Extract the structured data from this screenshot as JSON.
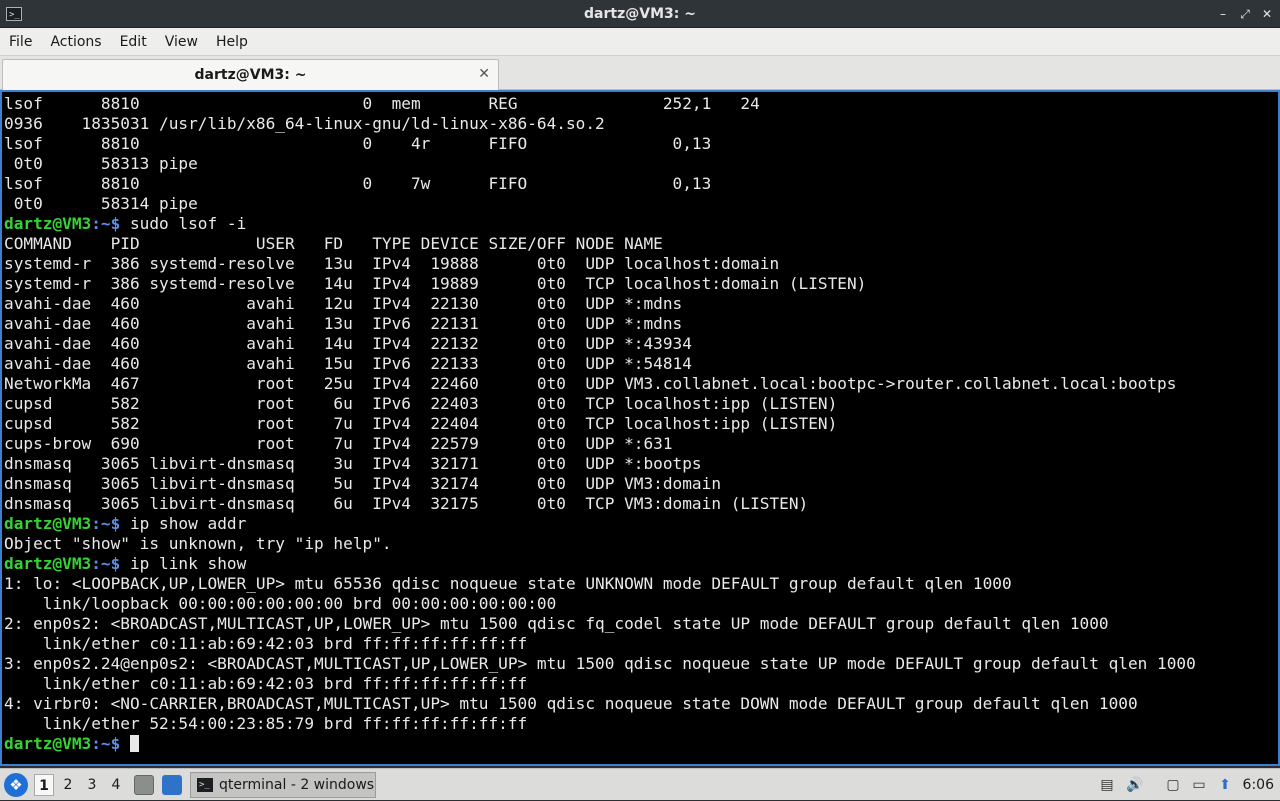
{
  "window": {
    "title": "dartz@VM3: ~",
    "app_icon_glyph": ">_",
    "buttons": {
      "minimize": "–",
      "maximize": "⤢",
      "close": "✕"
    }
  },
  "menubar": {
    "items": [
      "File",
      "Actions",
      "Edit",
      "View",
      "Help"
    ]
  },
  "tabs": [
    {
      "label": "dartz@VM3: ~",
      "close": "✕"
    }
  ],
  "terminal": {
    "colors": {
      "background": "#000000",
      "text": "#e9e9e9",
      "prompt_user": "#35d435",
      "prompt_path": "#5b8fe8"
    },
    "lines": [
      {
        "text": "lsof      8810                       0  mem       REG               252,1   24"
      },
      {
        "text": "0936    1835031 /usr/lib/x86_64-linux-gnu/ld-linux-x86-64.so.2"
      },
      {
        "text": "lsof      8810                       0    4r      FIFO               0,13"
      },
      {
        "text": " 0t0      58313 pipe"
      },
      {
        "text": "lsof      8810                       0    7w      FIFO               0,13"
      },
      {
        "text": " 0t0      58314 pipe"
      },
      {
        "prompt_user": "dartz@VM3",
        "prompt_path": ":~$",
        "text": " sudo lsof -i"
      },
      {
        "text": "COMMAND    PID            USER   FD   TYPE DEVICE SIZE/OFF NODE NAME"
      },
      {
        "text": "systemd-r  386 systemd-resolve   13u  IPv4  19888      0t0  UDP localhost:domain"
      },
      {
        "text": "systemd-r  386 systemd-resolve   14u  IPv4  19889      0t0  TCP localhost:domain (LISTEN)"
      },
      {
        "text": "avahi-dae  460           avahi   12u  IPv4  22130      0t0  UDP *:mdns"
      },
      {
        "text": "avahi-dae  460           avahi   13u  IPv6  22131      0t0  UDP *:mdns"
      },
      {
        "text": "avahi-dae  460           avahi   14u  IPv4  22132      0t0  UDP *:43934"
      },
      {
        "text": "avahi-dae  460           avahi   15u  IPv6  22133      0t0  UDP *:54814"
      },
      {
        "text": "NetworkMa  467            root   25u  IPv4  22460      0t0  UDP VM3.collabnet.local:bootpc->router.collabnet.local:bootps"
      },
      {
        "text": "cupsd      582            root    6u  IPv6  22403      0t0  TCP localhost:ipp (LISTEN)"
      },
      {
        "text": "cupsd      582            root    7u  IPv4  22404      0t0  TCP localhost:ipp (LISTEN)"
      },
      {
        "text": "cups-brow  690            root    7u  IPv4  22579      0t0  UDP *:631"
      },
      {
        "text": "dnsmasq   3065 libvirt-dnsmasq    3u  IPv4  32171      0t0  UDP *:bootps"
      },
      {
        "text": "dnsmasq   3065 libvirt-dnsmasq    5u  IPv4  32174      0t0  UDP VM3:domain"
      },
      {
        "text": "dnsmasq   3065 libvirt-dnsmasq    6u  IPv4  32175      0t0  TCP VM3:domain (LISTEN)"
      },
      {
        "prompt_user": "dartz@VM3",
        "prompt_path": ":~$",
        "text": " ip show addr"
      },
      {
        "text": "Object \"show\" is unknown, try \"ip help\"."
      },
      {
        "prompt_user": "dartz@VM3",
        "prompt_path": ":~$",
        "text": " ip link show"
      },
      {
        "text": "1: lo: <LOOPBACK,UP,LOWER_UP> mtu 65536 qdisc noqueue state UNKNOWN mode DEFAULT group default qlen 1000"
      },
      {
        "text": "    link/loopback 00:00:00:00:00:00 brd 00:00:00:00:00:00"
      },
      {
        "text": "2: enp0s2: <BROADCAST,MULTICAST,UP,LOWER_UP> mtu 1500 qdisc fq_codel state UP mode DEFAULT group default qlen 1000"
      },
      {
        "text": "    link/ether c0:11:ab:69:42:03 brd ff:ff:ff:ff:ff:ff"
      },
      {
        "text": "3: enp0s2.24@enp0s2: <BROADCAST,MULTICAST,UP,LOWER_UP> mtu 1500 qdisc noqueue state UP mode DEFAULT group default qlen 1000"
      },
      {
        "text": "    link/ether c0:11:ab:69:42:03 brd ff:ff:ff:ff:ff:ff"
      },
      {
        "text": "4: virbr0: <NO-CARRIER,BROADCAST,MULTICAST,UP> mtu 1500 qdisc noqueue state DOWN mode DEFAULT group default qlen 1000"
      },
      {
        "text": "    link/ether 52:54:00:23:85:79 brd ff:ff:ff:ff:ff:ff"
      },
      {
        "prompt_user": "dartz@VM3",
        "prompt_path": ":~$",
        "text": " ",
        "cursor": true
      }
    ]
  },
  "taskbar": {
    "desktops": [
      "1",
      "2",
      "3",
      "4"
    ],
    "active_desktop": "1",
    "task_label": "qterminal - 2 windows",
    "tray_icons": [
      "network-icon",
      "volume-icon",
      "clipboard-icon",
      "display-icon",
      "update-icon"
    ],
    "clock": "6:06"
  }
}
